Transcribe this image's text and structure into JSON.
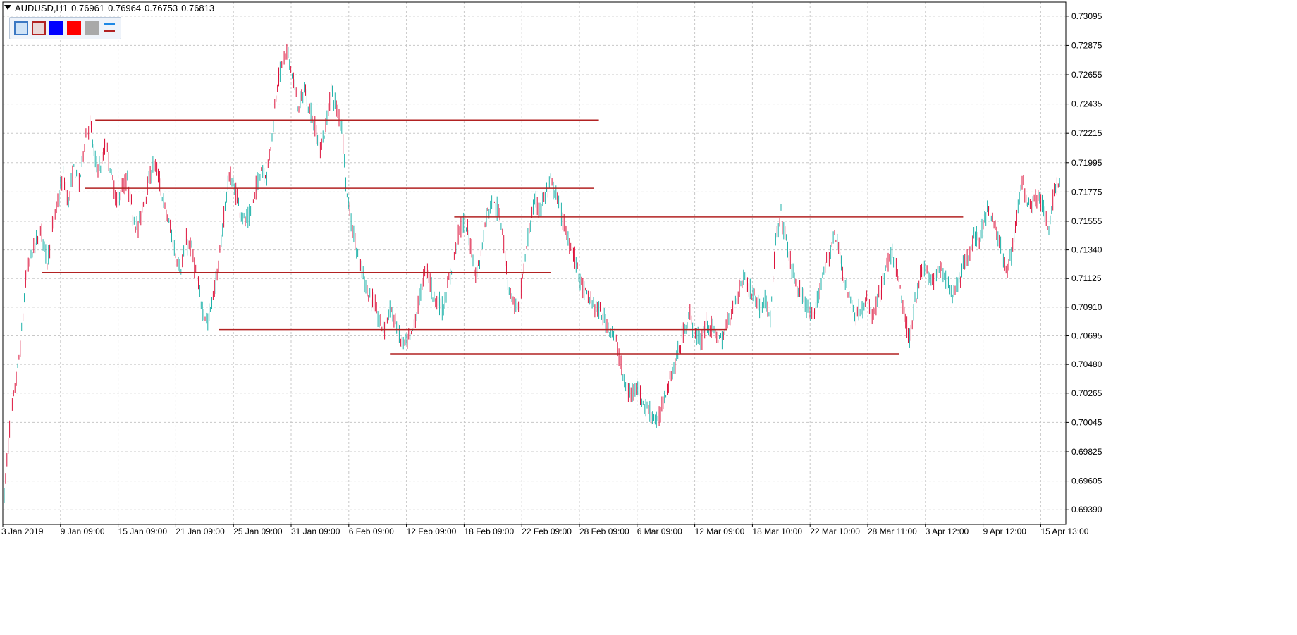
{
  "header": {
    "symbol": "AUDUSD,H1",
    "open": "0.76961",
    "high": "0.76964",
    "low": "0.76753",
    "close": "0.76813"
  },
  "toolbar": {
    "buttons": [
      {
        "name": "box-blue-outline-button",
        "fill": "#cfe3f7",
        "border": "#3b78c3"
      },
      {
        "name": "box-red-outline-button",
        "fill": "#e9d8d8",
        "border": "#b22222"
      },
      {
        "name": "blue-color-button",
        "fill": "#0000ff",
        "border": "#0000ff"
      },
      {
        "name": "red-color-button",
        "fill": "#ff0000",
        "border": "#ff0000"
      },
      {
        "name": "gray-color-button",
        "fill": "#a9a9a9",
        "border": "#a9a9a9"
      }
    ],
    "lines_icon": {
      "name": "line-style-icon",
      "top": "#1e88e5",
      "bottom": "#b22222"
    }
  },
  "colors": {
    "bull": "#20b2aa",
    "bear": "#dc143c",
    "level_line": "#b22222",
    "grid": "#c8c8c8",
    "axis": "#000000"
  },
  "chart_data": {
    "type": "line",
    "title": "AUDUSD,H1",
    "price_labels": [
      "0.73095",
      "0.72875",
      "0.72655",
      "0.72435",
      "0.72215",
      "0.71995",
      "0.71775",
      "0.71555",
      "0.71340",
      "0.71125",
      "0.70910",
      "0.70695",
      "0.70480",
      "0.70265",
      "0.70045",
      "0.69825",
      "0.69605",
      "0.69390"
    ],
    "date_labels": [
      "3 Jan 2019",
      "9 Jan 09:00",
      "15 Jan 09:00",
      "21 Jan 09:00",
      "25 Jan 09:00",
      "31 Jan 09:00",
      "6 Feb 09:00",
      "12 Feb 09:00",
      "18 Feb 09:00",
      "22 Feb 09:00",
      "28 Feb 09:00",
      "6 Mar 09:00",
      "12 Mar 09:00",
      "18 Mar 10:00",
      "22 Mar 10:00",
      "28 Mar 11:00",
      "3 Apr 12:00",
      "9 Apr 12:00",
      "15 Apr 13:00"
    ],
    "ylim": [
      0.6928,
      0.732
    ],
    "price_path": [
      [
        0,
        0.695
      ],
      [
        2,
        0.7
      ],
      [
        4,
        0.703
      ],
      [
        6,
        0.706
      ],
      [
        8,
        0.711
      ],
      [
        10,
        0.713
      ],
      [
        12,
        0.714
      ],
      [
        14,
        0.7148
      ],
      [
        16,
        0.7125
      ],
      [
        18,
        0.715
      ],
      [
        20,
        0.717
      ],
      [
        22,
        0.719
      ],
      [
        24,
        0.717
      ],
      [
        26,
        0.7195
      ],
      [
        28,
        0.7183
      ],
      [
        30,
        0.7215
      ],
      [
        32,
        0.723
      ],
      [
        34,
        0.72
      ],
      [
        36,
        0.7195
      ],
      [
        38,
        0.7215
      ],
      [
        40,
        0.719
      ],
      [
        42,
        0.717
      ],
      [
        44,
        0.718
      ],
      [
        46,
        0.7185
      ],
      [
        48,
        0.716
      ],
      [
        50,
        0.715
      ],
      [
        52,
        0.717
      ],
      [
        54,
        0.7185
      ],
      [
        56,
        0.72
      ],
      [
        58,
        0.7185
      ],
      [
        60,
        0.7165
      ],
      [
        62,
        0.715
      ],
      [
        64,
        0.713
      ],
      [
        66,
        0.712
      ],
      [
        68,
        0.714
      ],
      [
        70,
        0.7135
      ],
      [
        72,
        0.711
      ],
      [
        74,
        0.709
      ],
      [
        76,
        0.708
      ],
      [
        78,
        0.71
      ],
      [
        80,
        0.712
      ],
      [
        82,
        0.716
      ],
      [
        84,
        0.719
      ],
      [
        86,
        0.718
      ],
      [
        88,
        0.7165
      ],
      [
        90,
        0.7155
      ],
      [
        92,
        0.716
      ],
      [
        94,
        0.718
      ],
      [
        96,
        0.7195
      ],
      [
        98,
        0.719
      ],
      [
        100,
        0.722
      ],
      [
        102,
        0.726
      ],
      [
        104,
        0.7275
      ],
      [
        106,
        0.7282
      ],
      [
        108,
        0.726
      ],
      [
        110,
        0.724
      ],
      [
        112,
        0.7255
      ],
      [
        114,
        0.724
      ],
      [
        116,
        0.7225
      ],
      [
        118,
        0.721
      ],
      [
        120,
        0.7225
      ],
      [
        122,
        0.7255
      ],
      [
        124,
        0.724
      ],
      [
        126,
        0.7228
      ],
      [
        128,
        0.7175
      ],
      [
        130,
        0.715
      ],
      [
        132,
        0.713
      ],
      [
        134,
        0.7115
      ],
      [
        136,
        0.71
      ],
      [
        138,
        0.7095
      ],
      [
        140,
        0.708
      ],
      [
        142,
        0.7075
      ],
      [
        144,
        0.709
      ],
      [
        146,
        0.708
      ],
      [
        148,
        0.7065
      ],
      [
        150,
        0.7063
      ],
      [
        152,
        0.707
      ],
      [
        154,
        0.7085
      ],
      [
        156,
        0.711
      ],
      [
        158,
        0.712
      ],
      [
        160,
        0.71
      ],
      [
        162,
        0.7095
      ],
      [
        164,
        0.709
      ],
      [
        166,
        0.711
      ],
      [
        168,
        0.713
      ],
      [
        170,
        0.715
      ],
      [
        172,
        0.7155
      ],
      [
        174,
        0.714
      ],
      [
        176,
        0.7115
      ],
      [
        178,
        0.713
      ],
      [
        180,
        0.716
      ],
      [
        182,
        0.717
      ],
      [
        184,
        0.7165
      ],
      [
        186,
        0.715
      ],
      [
        188,
        0.711
      ],
      [
        190,
        0.7095
      ],
      [
        192,
        0.709
      ],
      [
        194,
        0.712
      ],
      [
        196,
        0.715
      ],
      [
        198,
        0.717
      ],
      [
        200,
        0.7165
      ],
      [
        202,
        0.7175
      ],
      [
        204,
        0.7185
      ],
      [
        206,
        0.7175
      ],
      [
        208,
        0.716
      ],
      [
        210,
        0.7145
      ],
      [
        212,
        0.7135
      ],
      [
        214,
        0.712
      ],
      [
        216,
        0.7105
      ],
      [
        218,
        0.7098
      ],
      [
        220,
        0.7093
      ],
      [
        222,
        0.7088
      ],
      [
        224,
        0.7082
      ],
      [
        226,
        0.7075
      ],
      [
        228,
        0.707
      ],
      [
        230,
        0.705
      ],
      [
        232,
        0.703
      ],
      [
        234,
        0.7025
      ],
      [
        236,
        0.7035
      ],
      [
        238,
        0.702
      ],
      [
        240,
        0.7015
      ],
      [
        242,
        0.701
      ],
      [
        244,
        0.7004
      ],
      [
        246,
        0.702
      ],
      [
        248,
        0.7035
      ],
      [
        250,
        0.7045
      ],
      [
        252,
        0.706
      ],
      [
        254,
        0.7075
      ],
      [
        256,
        0.7085
      ],
      [
        258,
        0.707
      ],
      [
        260,
        0.7065
      ],
      [
        262,
        0.708
      ],
      [
        264,
        0.7075
      ],
      [
        266,
        0.707
      ],
      [
        268,
        0.7065
      ],
      [
        270,
        0.708
      ],
      [
        272,
        0.709
      ],
      [
        274,
        0.71
      ],
      [
        276,
        0.7115
      ],
      [
        278,
        0.7105
      ],
      [
        280,
        0.71
      ],
      [
        282,
        0.709
      ],
      [
        284,
        0.71
      ],
      [
        286,
        0.708
      ],
      [
        288,
        0.714
      ],
      [
        290,
        0.716
      ],
      [
        292,
        0.714
      ],
      [
        294,
        0.712
      ],
      [
        296,
        0.7105
      ],
      [
        298,
        0.71
      ],
      [
        300,
        0.709
      ],
      [
        302,
        0.708
      ],
      [
        304,
        0.71
      ],
      [
        306,
        0.712
      ],
      [
        308,
        0.713
      ],
      [
        310,
        0.7145
      ],
      [
        312,
        0.713
      ],
      [
        314,
        0.711
      ],
      [
        316,
        0.7095
      ],
      [
        318,
        0.7085
      ],
      [
        320,
        0.709
      ],
      [
        322,
        0.7095
      ],
      [
        324,
        0.7085
      ],
      [
        326,
        0.7095
      ],
      [
        328,
        0.711
      ],
      [
        330,
        0.7125
      ],
      [
        332,
        0.713
      ],
      [
        334,
        0.711
      ],
      [
        336,
        0.7085
      ],
      [
        338,
        0.7065
      ],
      [
        340,
        0.7095
      ],
      [
        342,
        0.7115
      ],
      [
        344,
        0.712
      ],
      [
        346,
        0.711
      ],
      [
        348,
        0.7115
      ],
      [
        350,
        0.712
      ],
      [
        352,
        0.711
      ],
      [
        354,
        0.71
      ],
      [
        356,
        0.711
      ],
      [
        358,
        0.712
      ],
      [
        360,
        0.713
      ],
      [
        362,
        0.7145
      ],
      [
        364,
        0.714
      ],
      [
        366,
        0.716
      ],
      [
        368,
        0.7165
      ],
      [
        370,
        0.715
      ],
      [
        372,
        0.7135
      ],
      [
        374,
        0.712
      ],
      [
        376,
        0.713
      ],
      [
        378,
        0.716
      ],
      [
        380,
        0.7185
      ],
      [
        382,
        0.717
      ],
      [
        384,
        0.717
      ],
      [
        386,
        0.7175
      ],
      [
        388,
        0.7165
      ],
      [
        390,
        0.7145
      ],
      [
        392,
        0.718
      ],
      [
        394,
        0.7185
      ]
    ],
    "series": [
      {
        "name": "resistance-0.7231",
        "type": "horizontal-line",
        "y": 0.72315,
        "x_from": 34,
        "x_to": 222
      },
      {
        "name": "level-0.7180",
        "type": "horizontal-line",
        "y": 0.71803,
        "x_from": 30,
        "x_to": 220
      },
      {
        "name": "level-0.7158",
        "type": "horizontal-line",
        "y": 0.71587,
        "x_from": 168,
        "x_to": 358
      },
      {
        "name": "level-0.7117",
        "type": "horizontal-line",
        "y": 0.7117,
        "x_from": 14,
        "x_to": 204
      },
      {
        "name": "level-0.7074",
        "type": "horizontal-line",
        "y": 0.70742,
        "x_from": 80,
        "x_to": 270
      },
      {
        "name": "support-0.7056",
        "type": "horizontal-line",
        "y": 0.7056,
        "x_from": 144,
        "x_to": 334
      }
    ],
    "grid": true
  }
}
